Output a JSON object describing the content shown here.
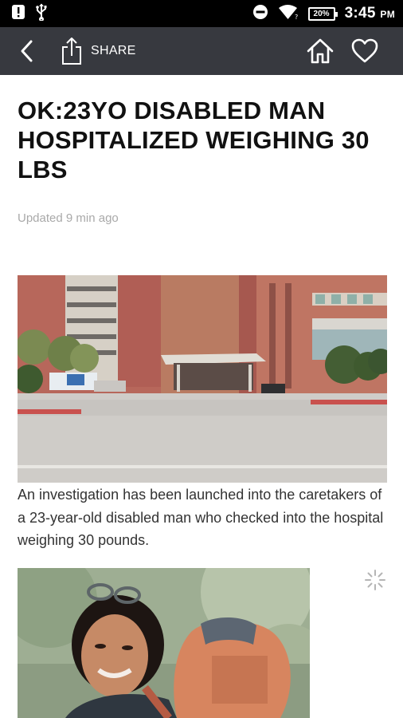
{
  "status_bar": {
    "time": "3:45",
    "time_suffix": "PM",
    "battery": "20%"
  },
  "toolbar": {
    "share_label": "SHARE",
    "icons": [
      "back-arrow",
      "share",
      "home",
      "heart"
    ]
  },
  "article": {
    "title": "OK:23YO DISABLED MAN HOSPITALIZED WEIGHING 30 LBS",
    "updated": "Updated 9 min ago",
    "caption": "An investigation has been launched into the caretakers of a 23-year-old disabled man who checked into the hospital weighing 30 pounds."
  },
  "colors": {
    "toolbar_bg": "#37393f",
    "status_bg": "#000000",
    "title": "#111111",
    "updated": "#a9a9a9",
    "caption": "#333333"
  }
}
